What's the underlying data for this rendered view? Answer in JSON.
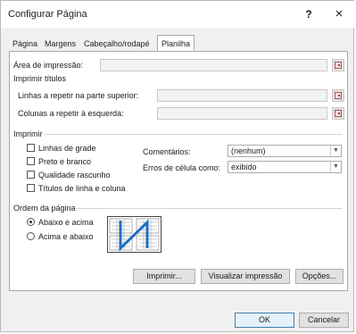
{
  "window": {
    "title": "Configurar Página",
    "help": "?",
    "close": "×"
  },
  "tabs": [
    {
      "label": "Página"
    },
    {
      "label": "Margens"
    },
    {
      "label": "Cabeçalho/rodapé"
    },
    {
      "label": "Planilha"
    }
  ],
  "print_area": {
    "label": "Área de impressão:",
    "value": ""
  },
  "print_titles": {
    "heading": "Imprimir títulos",
    "rows_label": "Linhas a repetir na parte superior:",
    "rows_value": "",
    "cols_label": "Colunas a repetir à esquerda:",
    "cols_value": ""
  },
  "print": {
    "heading": "Imprimir",
    "gridlines": "Linhas de grade",
    "bw": "Preto e branco",
    "draft": "Qualidade rascunho",
    "headings": "Títulos de linha e coluna",
    "comments_label": "Comentários:",
    "comments_value": "(nenhum)",
    "errors_label": "Erros de célula como:",
    "errors_value": "exibido"
  },
  "page_order": {
    "heading": "Ordem da página",
    "down_then_over": "Abaixo e acima",
    "over_then_down": "Acima e abaixo",
    "selected": "down_then_over"
  },
  "buttons": {
    "print": "Imprimir...",
    "preview": "Visualizar impressão",
    "options": "Opções...",
    "ok": "OK",
    "cancel": "Cancelar"
  },
  "colors": {
    "accent": "#3c7fb1",
    "panel": "#ffffff",
    "dialog": "#f0f0f0"
  }
}
